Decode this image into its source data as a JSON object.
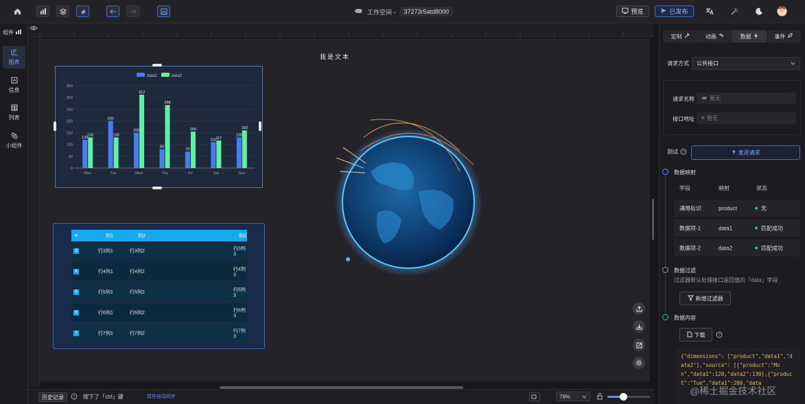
{
  "topbar": {
    "workspace_label": "工作空间 -",
    "workspace_id": "37273r5atd8000",
    "preview_label": "预览",
    "publish_label": "已发布"
  },
  "leftbar": {
    "title": "组件",
    "items": [
      {
        "label": "图表",
        "icon": "chart-icon",
        "active": true
      },
      {
        "label": "信息",
        "icon": "info-icon"
      },
      {
        "label": "列表",
        "icon": "table-icon"
      },
      {
        "label": "小组件",
        "icon": "widget-icon"
      }
    ]
  },
  "canvas": {
    "title": "我是文本"
  },
  "chart_data": {
    "type": "bar",
    "categories": [
      "Mon",
      "Tue",
      "Wed",
      "Thu",
      "Fri",
      "Sat",
      "Sun"
    ],
    "series": [
      {
        "name": "data1",
        "values": [
          120,
          200,
          150,
          80,
          70,
          110,
          130
        ],
        "color": "#4a7cf0"
      },
      {
        "name": "data2",
        "values": [
          130,
          130,
          312,
          268,
          155,
          117,
          160
        ],
        "color": "#5ef0a4"
      }
    ],
    "yticks": [
      0,
      50,
      100,
      150,
      200,
      250,
      300,
      350
    ],
    "ylim": [
      0,
      350
    ],
    "legend": "top"
  },
  "table": {
    "headers": [
      "#",
      "列1",
      "列2",
      "列3"
    ],
    "rows": [
      {
        "idx": "3",
        "c1": "行3列1",
        "c2": "行3列2",
        "c3": "行3列3"
      },
      {
        "idx": "4",
        "c1": "行4列1",
        "c2": "行4列2",
        "c3": "行4列3"
      },
      {
        "idx": "5",
        "c1": "行5列1",
        "c2": "行5列2",
        "c3": "行5列3"
      },
      {
        "idx": "6",
        "c1": "行6列1",
        "c2": "行6列2",
        "c3": "行6列3"
      },
      {
        "idx": "7",
        "c1": "行7列1",
        "c2": "行7列2",
        "c3": "行7列3"
      }
    ]
  },
  "bottombar": {
    "history_label": "历史记录",
    "status_text": "按下了「ctrl」键",
    "sync_text": "暂存自动同步",
    "zoom": "76%"
  },
  "rightpanel": {
    "tabs": [
      {
        "label": "定制",
        "icon": "tools-icon"
      },
      {
        "label": "动画",
        "icon": "animation-icon"
      },
      {
        "label": "数据",
        "icon": "bolt-icon",
        "active": true
      },
      {
        "label": "事件",
        "icon": "rocket-icon"
      }
    ],
    "request_method_label": "请求方式",
    "request_method_value": "公共接口",
    "request_name_label": "请求名称",
    "request_name_value": "暂无",
    "api_addr_label": "接口地址",
    "api_addr_value": "暂无",
    "test_label": "测试",
    "send_label": "发送请求",
    "mapping_title": "数据映射",
    "mapping_headers": [
      "字段",
      "映射",
      "状态"
    ],
    "mapping_rows": [
      {
        "field": "通用标识",
        "map": "product",
        "status": "无"
      },
      {
        "field": "数据项-1",
        "map": "data1",
        "status": "匹配成功"
      },
      {
        "field": "数据项-2",
        "map": "data2",
        "status": "匹配成功"
      }
    ],
    "filter_title": "数据过滤",
    "filter_desc": "过滤器默认处理接口返回值的「data」字段",
    "add_filter_label": "新增过滤器",
    "content_title": "数据内容",
    "download_label": "下载",
    "code_text": "{\"dimensions\": [\"product\",\"data1\",\"data2\"],\"source\": [{\"product\":\"Mon\",\"data1\":120,\"data2\":130},{\"product\":\"Tue\",\"data1\":200,\"data"
  },
  "watermark": "@稀土掘金技术社区"
}
